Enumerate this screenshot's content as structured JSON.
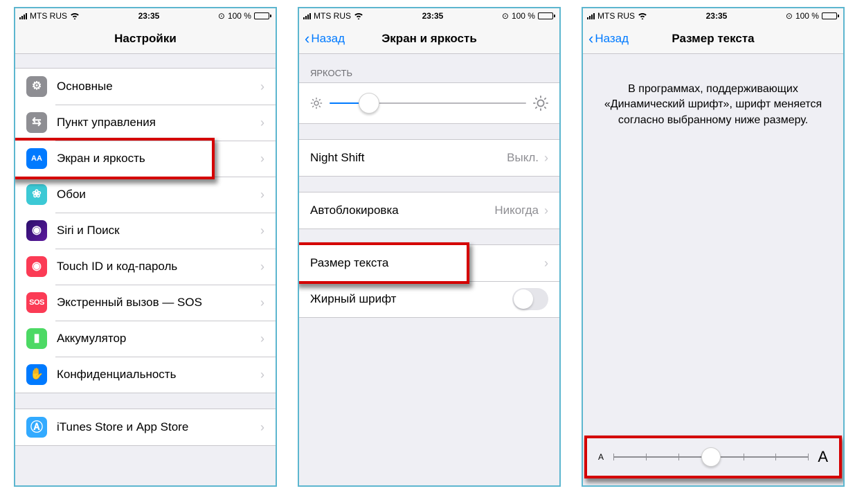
{
  "status": {
    "carrier": "MTS RUS",
    "time": "23:35",
    "battery_text": "100 %",
    "lock_glyph": "⊙"
  },
  "screen1": {
    "title": "Настройки",
    "rows": [
      {
        "key": "general",
        "label": "Основные",
        "glyph": "⚙"
      },
      {
        "key": "control",
        "label": "Пункт управления",
        "glyph": "⇆"
      },
      {
        "key": "display",
        "label": "Экран и яркость",
        "glyph": "AA"
      },
      {
        "key": "wallpaper",
        "label": "Обои",
        "glyph": "❀"
      },
      {
        "key": "siri",
        "label": "Siri и Поиск",
        "glyph": "◉"
      },
      {
        "key": "touchid",
        "label": "Touch ID и код-пароль",
        "glyph": "◉"
      },
      {
        "key": "sos",
        "label": "Экстренный вызов — SOS",
        "glyph": "SOS"
      },
      {
        "key": "battery",
        "label": "Аккумулятор",
        "glyph": "▮"
      },
      {
        "key": "privacy",
        "label": "Конфиденциальность",
        "glyph": "✋"
      }
    ],
    "itunes_label": "iTunes Store и App Store",
    "itunes_glyph": "Ⓐ"
  },
  "screen2": {
    "back": "Назад",
    "title": "Экран и яркость",
    "section_brightness": "ЯРКОСТЬ",
    "brightness_percent": 20,
    "night_shift_label": "Night Shift",
    "night_shift_value": "Выкл.",
    "autolock_label": "Автоблокировка",
    "autolock_value": "Никогда",
    "text_size_label": "Размер текста",
    "bold_label": "Жирный шрифт",
    "bold_on": false
  },
  "screen3": {
    "back": "Назад",
    "title": "Размер текста",
    "info": "В программах, поддерживающих «Динамический шрифт», шрифт меняется согласно выбранному ниже размеру.",
    "slider_steps": 7,
    "slider_index": 3,
    "small_a": "A",
    "big_a": "A"
  }
}
